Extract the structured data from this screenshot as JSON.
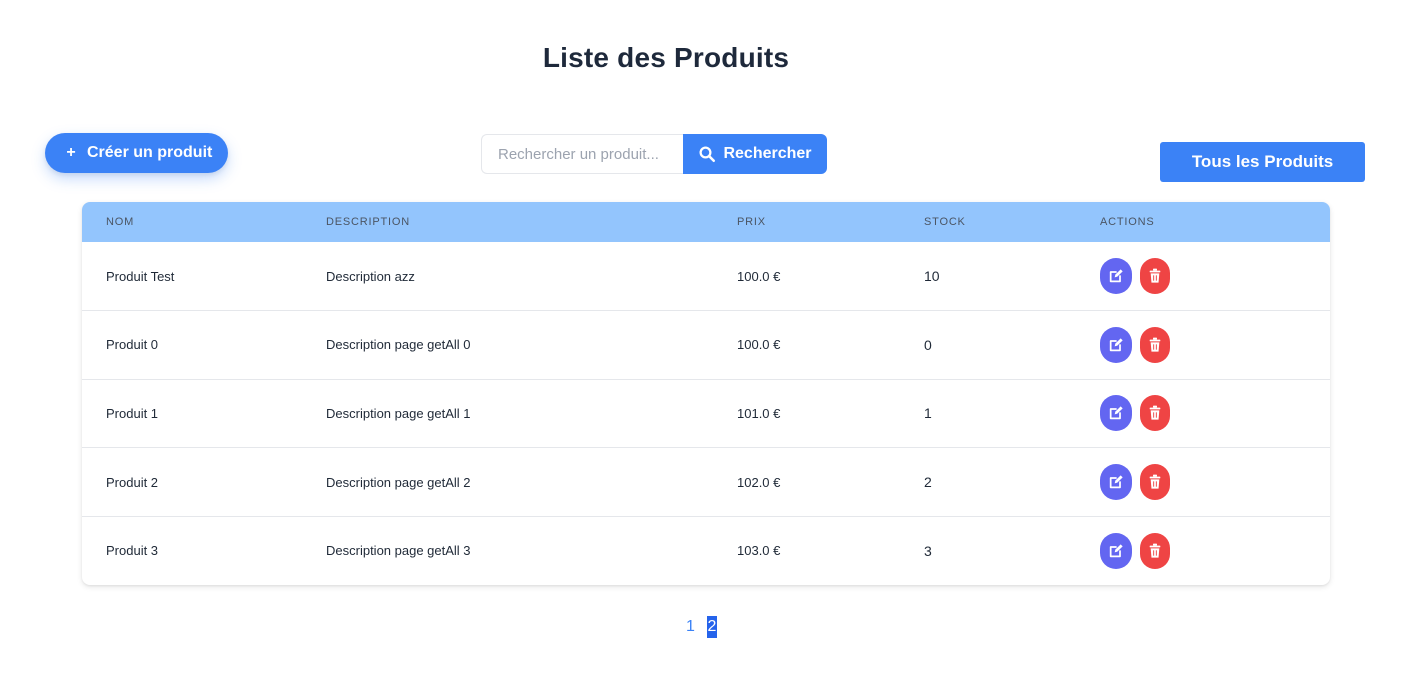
{
  "header": {
    "title": "Liste des Produits"
  },
  "toolbar": {
    "create_plus": "+",
    "create_label": "Créer un produit",
    "search_placeholder": "Rechercher un produit...",
    "search_value": "",
    "search_button": "Rechercher",
    "all_products": "Tous les Produits"
  },
  "table": {
    "headers": [
      "NOM",
      "DESCRIPTION",
      "PRIX",
      "STOCK",
      "ACTIONS"
    ],
    "rows": [
      {
        "nom": "Produit Test",
        "description": "Description azz",
        "prix": "100.0 €",
        "stock": "10"
      },
      {
        "nom": "Produit 0",
        "description": "Description page getAll 0",
        "prix": "100.0 €",
        "stock": "0"
      },
      {
        "nom": "Produit 1",
        "description": "Description page getAll 1",
        "prix": "101.0 €",
        "stock": "1"
      },
      {
        "nom": "Produit 2",
        "description": "Description page getAll 2",
        "prix": "102.0 €",
        "stock": "2"
      },
      {
        "nom": "Produit 3",
        "description": "Description page getAll 3",
        "prix": "103.0 €",
        "stock": "3"
      }
    ],
    "action_icons": {
      "edit": "edit-icon",
      "delete": "trash-icon"
    }
  },
  "pagination": {
    "pages": [
      "1",
      "2"
    ],
    "current": "2"
  },
  "colors": {
    "primary": "#3b82f6",
    "header_bg": "#93c5fd",
    "edit": "#6366f1",
    "delete": "#ef4444",
    "active_page": "#2563eb"
  }
}
